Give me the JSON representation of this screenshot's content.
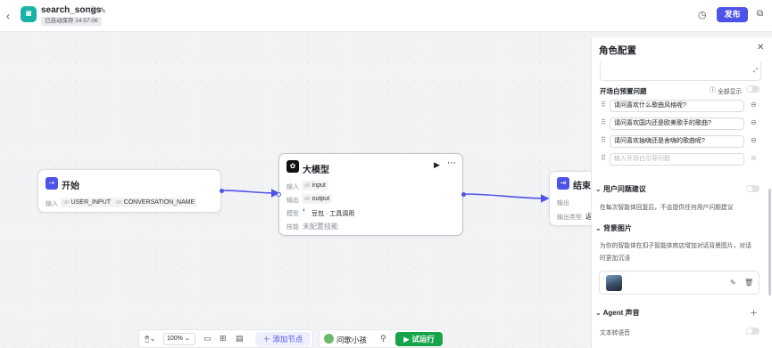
{
  "header": {
    "back_icon": "chevron-left-icon",
    "app_icon": "chat-bubble-icon",
    "app_title": "search_songs",
    "save_status": "已自动保存 14:57:06",
    "publish_label": "发布"
  },
  "nodes": {
    "start": {
      "title": "开始",
      "input_label": "输入",
      "params": [
        {
          "type": "str",
          "name": "USER_INPUT"
        },
        {
          "type": "str",
          "name": "CONVERSATION_NAME"
        }
      ]
    },
    "llm": {
      "title": "大模型",
      "input_label": "输入",
      "input_param": {
        "type": "str",
        "name": "input"
      },
      "output_label": "输出",
      "output_param": {
        "type": "str",
        "name": "output"
      },
      "model_label": "模型",
      "model_value": "豆包 · 工具调用",
      "skills_label": "技能",
      "skills_value": "未配置技能"
    },
    "end": {
      "title": "结束",
      "output_label": "输出",
      "output_type_label": "输出类型",
      "output_type_value": "返"
    }
  },
  "toolbar": {
    "zoom": "100%",
    "add_node_label": "添加节点",
    "agent_name": "问歌小孩",
    "test_run_label": "试运行"
  },
  "panel": {
    "title": "角色配置",
    "prologue_preset_label": "开场白预置问题",
    "show_all_label": "全部显示",
    "questions": [
      "请问喜欢什么歌曲风格呢?",
      "请问喜欢国内还是欧美歌手的歌曲?",
      "请问喜欢抽嗨还是舍嗨的歌曲呢?"
    ],
    "question_placeholder": "输入开场白引导问题",
    "user_suggestion_title": "用户问题建议",
    "user_suggestion_desc": "在每次智能体回复后，不会提供任何用户问题建议",
    "bg_image_title": "背景图片",
    "bg_image_desc_1": "为你的智能体在扣子智能体商店增加对话背景图片，对话",
    "bg_image_desc_2": "时更加沉浸",
    "agent_voice_title": "Agent 声音",
    "tts_label": "文本转语音"
  }
}
